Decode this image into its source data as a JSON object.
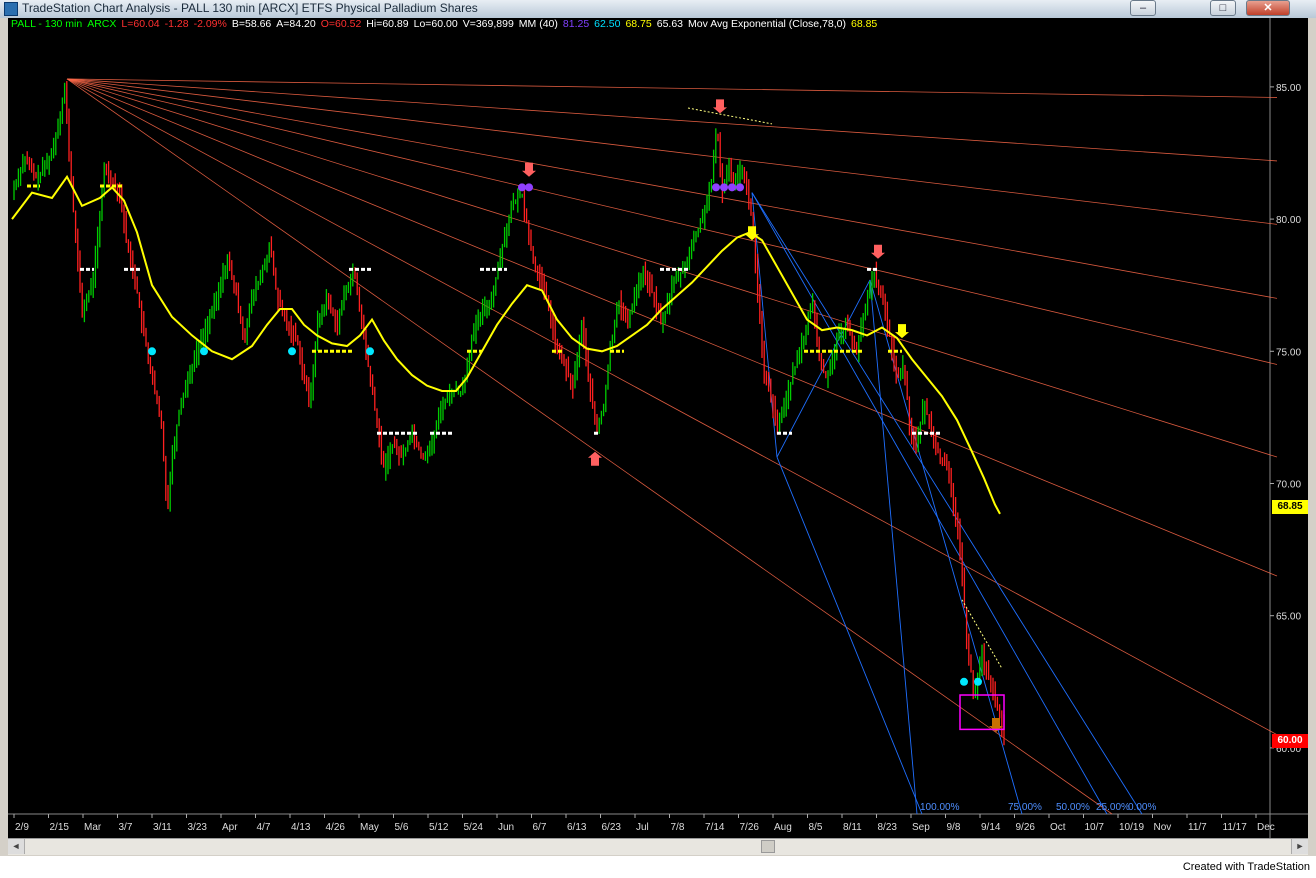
{
  "window": {
    "title": "TradeStation Chart Analysis - PALL 130 min [ARCX] ETFS Physical Palladium Shares",
    "minimize": "–",
    "maximize": "□",
    "close": "✕",
    "icon": "tradestation-icon"
  },
  "legend": [
    {
      "text": "PALL - 130 min",
      "color": "#00ff00"
    },
    {
      "text": "ARCX",
      "color": "#00ff00"
    },
    {
      "text": "L=60.04",
      "color": "#ff3030"
    },
    {
      "text": "-1.28",
      "color": "#ff3030"
    },
    {
      "text": "-2.09%",
      "color": "#ff3030"
    },
    {
      "text": "B=58.66",
      "color": "#ffffff"
    },
    {
      "text": "A=84.20",
      "color": "#ffffff"
    },
    {
      "text": "O=60.52",
      "color": "#ff3030"
    },
    {
      "text": "Hi=60.89",
      "color": "#ffffff"
    },
    {
      "text": "Lo=60.00",
      "color": "#ffffff"
    },
    {
      "text": "V=369,899",
      "color": "#ffffff"
    },
    {
      "text": "MM (40)",
      "color": "#ffffff"
    },
    {
      "text": "81.25",
      "color": "#8040ff"
    },
    {
      "text": "62.50",
      "color": "#00e0ff"
    },
    {
      "text": "68.75",
      "color": "#ffff00"
    },
    {
      "text": "65.63",
      "color": "#ffffff"
    },
    {
      "text": "Mov Avg Exponential (Close,78,0)",
      "color": "#ffffff"
    },
    {
      "text": "68.85",
      "color": "#ffff00"
    }
  ],
  "colors": {
    "up": "#00cc00",
    "down": "#ff2020",
    "ema": "#ffff00",
    "fan": "#ff6a4a",
    "pitch": "#1f6fff",
    "price_tag_ema": "#ffff00",
    "price_tag_last": "#ff0000",
    "purple": "#9040ff",
    "cyan": "#00e8ff",
    "magenta": "#ff00ff"
  },
  "chart_data": {
    "type": "line",
    "symbol": "PALL",
    "ylim": [
      57.5,
      87.0
    ],
    "y_ticks": [
      "85.00",
      "80.00",
      "75.00",
      "70.00",
      "65.00",
      "60.00"
    ],
    "x_ticks": [
      "2/9",
      "2/15",
      "Mar",
      "3/7",
      "3/11",
      "3/23",
      "Apr",
      "4/7",
      "4/13",
      "4/26",
      "May",
      "5/6",
      "5/12",
      "5/24",
      "Jun",
      "6/7",
      "6/13",
      "6/23",
      "Jul",
      "7/8",
      "7/14",
      "7/26",
      "Aug",
      "8/5",
      "8/11",
      "8/23",
      "Sep",
      "9/8",
      "9/14",
      "9/26",
      "Oct",
      "10/7",
      "10/19",
      "Nov",
      "11/7",
      "11/17",
      "Dec"
    ],
    "price_tags": [
      {
        "value": "68.85",
        "kind": "ema"
      },
      {
        "value": "60.00",
        "kind": "last"
      }
    ],
    "price_path": [
      [
        0,
        81
      ],
      [
        12,
        82.3
      ],
      [
        25,
        81.5
      ],
      [
        40,
        82.5
      ],
      [
        48,
        84
      ],
      [
        53,
        85
      ],
      [
        56,
        83
      ],
      [
        62,
        80
      ],
      [
        70,
        76.5
      ],
      [
        80,
        77.5
      ],
      [
        88,
        80
      ],
      [
        92,
        82
      ],
      [
        100,
        81.5
      ],
      [
        108,
        81
      ],
      [
        115,
        79
      ],
      [
        122,
        78
      ],
      [
        130,
        76
      ],
      [
        135,
        75
      ],
      [
        140,
        74
      ],
      [
        150,
        72
      ],
      [
        155,
        69
      ],
      [
        160,
        71
      ],
      [
        168,
        73
      ],
      [
        176,
        74
      ],
      [
        185,
        75
      ],
      [
        195,
        76
      ],
      [
        205,
        77
      ],
      [
        215,
        78.5
      ],
      [
        225,
        77
      ],
      [
        232,
        75.5
      ],
      [
        240,
        77
      ],
      [
        250,
        78
      ],
      [
        258,
        79
      ],
      [
        265,
        77
      ],
      [
        275,
        76
      ],
      [
        285,
        75.5
      ],
      [
        292,
        74
      ],
      [
        298,
        73
      ],
      [
        305,
        76
      ],
      [
        315,
        77
      ],
      [
        325,
        76
      ],
      [
        335,
        77.5
      ],
      [
        342,
        78
      ],
      [
        350,
        76
      ],
      [
        358,
        74
      ],
      [
        366,
        72
      ],
      [
        372,
        70.5
      ],
      [
        380,
        71.5
      ],
      [
        390,
        71
      ],
      [
        400,
        72
      ],
      [
        410,
        71
      ],
      [
        420,
        71.5
      ],
      [
        430,
        73
      ],
      [
        440,
        73.5
      ],
      [
        450,
        73.5
      ],
      [
        460,
        75.5
      ],
      [
        470,
        76.5
      ],
      [
        480,
        77
      ],
      [
        490,
        79
      ],
      [
        500,
        80.5
      ],
      [
        510,
        81
      ],
      [
        518,
        79
      ],
      [
        525,
        78
      ],
      [
        535,
        77
      ],
      [
        545,
        75
      ],
      [
        553,
        74.5
      ],
      [
        560,
        73.5
      ],
      [
        570,
        76
      ],
      [
        580,
        73
      ],
      [
        585,
        72
      ],
      [
        592,
        73
      ],
      [
        598,
        75
      ],
      [
        606,
        77
      ],
      [
        615,
        76
      ],
      [
        625,
        77.5
      ],
      [
        632,
        78
      ],
      [
        642,
        77
      ],
      [
        650,
        76
      ],
      [
        660,
        77.5
      ],
      [
        670,
        78
      ],
      [
        680,
        79
      ],
      [
        690,
        80
      ],
      [
        700,
        81.5
      ],
      [
        705,
        83.5
      ],
      [
        710,
        81
      ],
      [
        716,
        82
      ],
      [
        722,
        81.5
      ],
      [
        730,
        82
      ],
      [
        740,
        80
      ],
      [
        746,
        77
      ],
      [
        752,
        74
      ],
      [
        758,
        73.5
      ],
      [
        765,
        72
      ],
      [
        772,
        73
      ],
      [
        780,
        74
      ],
      [
        788,
        75
      ],
      [
        795,
        76
      ],
      [
        800,
        77
      ],
      [
        808,
        74.5
      ],
      [
        815,
        74
      ],
      [
        825,
        75.5
      ],
      [
        835,
        76
      ],
      [
        845,
        75
      ],
      [
        855,
        77
      ],
      [
        862,
        78
      ],
      [
        870,
        77
      ],
      [
        878,
        75.5
      ],
      [
        885,
        74
      ],
      [
        892,
        74.5
      ],
      [
        898,
        72
      ],
      [
        905,
        71.5
      ],
      [
        912,
        73
      ],
      [
        920,
        72
      ],
      [
        928,
        71
      ],
      [
        935,
        70.5
      ],
      [
        945,
        68.5
      ],
      [
        950,
        66.5
      ],
      [
        955,
        64
      ],
      [
        962,
        62
      ],
      [
        970,
        63.5
      ],
      [
        978,
        62.5
      ],
      [
        985,
        61.5
      ],
      [
        992,
        60.5
      ],
      [
        996,
        60
      ]
    ],
    "ema_path": [
      [
        0,
        80
      ],
      [
        20,
        81
      ],
      [
        40,
        80.8
      ],
      [
        55,
        81.6
      ],
      [
        70,
        80.5
      ],
      [
        88,
        80.8
      ],
      [
        100,
        81.2
      ],
      [
        112,
        80.7
      ],
      [
        125,
        79.5
      ],
      [
        140,
        77.5
      ],
      [
        160,
        76.3
      ],
      [
        180,
        75.6
      ],
      [
        200,
        75.0
      ],
      [
        220,
        74.7
      ],
      [
        240,
        75.2
      ],
      [
        255,
        76.0
      ],
      [
        268,
        76.6
      ],
      [
        280,
        76.6
      ],
      [
        292,
        76.0
      ],
      [
        305,
        75.6
      ],
      [
        320,
        75.3
      ],
      [
        335,
        75.2
      ],
      [
        348,
        75.6
      ],
      [
        360,
        76.2
      ],
      [
        372,
        75.4
      ],
      [
        385,
        74.7
      ],
      [
        400,
        74.1
      ],
      [
        415,
        73.7
      ],
      [
        430,
        73.5
      ],
      [
        444,
        73.5
      ],
      [
        455,
        74.0
      ],
      [
        470,
        75.0
      ],
      [
        485,
        76.0
      ],
      [
        500,
        76.8
      ],
      [
        515,
        77.5
      ],
      [
        530,
        77.3
      ],
      [
        545,
        76.2
      ],
      [
        560,
        75.5
      ],
      [
        575,
        75.1
      ],
      [
        590,
        75.0
      ],
      [
        605,
        75.2
      ],
      [
        620,
        75.6
      ],
      [
        635,
        76.0
      ],
      [
        650,
        76.6
      ],
      [
        665,
        77.1
      ],
      [
        680,
        77.6
      ],
      [
        695,
        78.2
      ],
      [
        710,
        78.8
      ],
      [
        725,
        79.3
      ],
      [
        738,
        79.5
      ],
      [
        750,
        79.2
      ],
      [
        765,
        78.2
      ],
      [
        780,
        77.2
      ],
      [
        795,
        76.2
      ],
      [
        810,
        75.8
      ],
      [
        825,
        75.9
      ],
      [
        840,
        75.8
      ],
      [
        855,
        75.6
      ],
      [
        870,
        75.9
      ],
      [
        885,
        75.5
      ],
      [
        900,
        74.7
      ],
      [
        915,
        74.0
      ],
      [
        930,
        73.3
      ],
      [
        945,
        72.4
      ],
      [
        960,
        71.2
      ],
      [
        972,
        70.2
      ],
      [
        983,
        69.2
      ],
      [
        988,
        68.85
      ]
    ],
    "fan_origin": [
      55,
      85.3
    ],
    "fan_ends": [
      [
        1265,
        84.6
      ],
      [
        1265,
        82.2
      ],
      [
        1265,
        79.8
      ],
      [
        1265,
        77.0
      ],
      [
        1265,
        74.5
      ],
      [
        1265,
        71.0
      ],
      [
        1265,
        66.5
      ],
      [
        1265,
        60.5
      ],
      [
        1100,
        57.5
      ]
    ],
    "pitchfork_lines": [
      [
        [
          858,
          77.7
        ],
        [
          905,
          57.5
        ]
      ],
      [
        [
          765,
          71.0
        ],
        [
          910,
          57.5
        ]
      ],
      [
        [
          858,
          77.7
        ],
        [
          1010,
          57.5
        ]
      ],
      [
        [
          740,
          81.0
        ],
        [
          1095,
          57.5
        ]
      ],
      [
        [
          740,
          81.0
        ],
        [
          1130,
          57.5
        ]
      ]
    ],
    "pitchfork_labels": [
      "100.00%",
      "75.00%",
      "50.00%",
      "25.00%",
      "0.00%"
    ]
  },
  "status": {
    "created": "Created with TradeStation"
  },
  "scroll": {
    "left": "◄",
    "right": "►"
  }
}
